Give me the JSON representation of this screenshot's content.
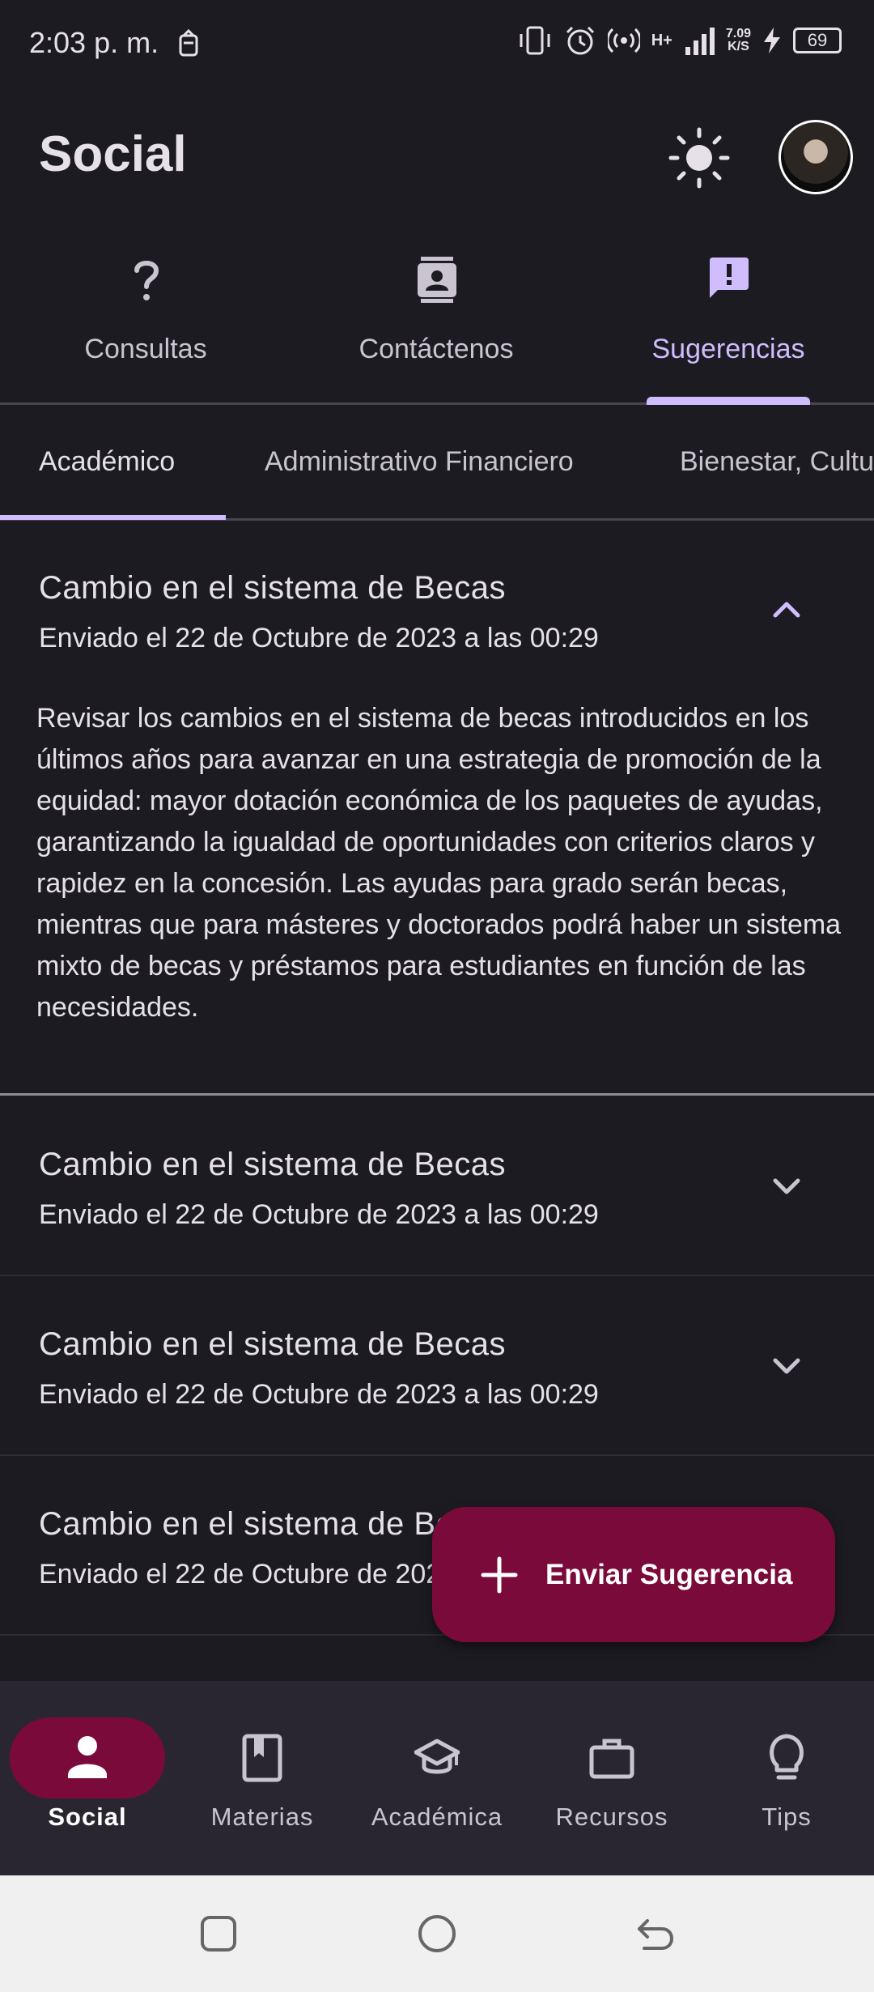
{
  "status_bar": {
    "time": "2:03 p. m.",
    "network": "H+",
    "speed_value": "7.09",
    "speed_unit": "K/S",
    "battery": "69"
  },
  "header": {
    "title": "Social"
  },
  "top_tabs": [
    {
      "label": "Consultas",
      "icon": "question-icon"
    },
    {
      "label": "Contáctenos",
      "icon": "contact-icon"
    },
    {
      "label": "Sugerencias",
      "icon": "feedback-icon",
      "active": true
    }
  ],
  "sub_tabs": [
    {
      "label": "Académico",
      "active": true
    },
    {
      "label": "Administrativo Financiero"
    },
    {
      "label": "Bienestar, Cultu"
    }
  ],
  "suggestions": [
    {
      "title": "Cambio en el sistema de Becas",
      "subtitle": "Enviado el 22 de Octubre de 2023 a las 00:29",
      "expanded": true,
      "body": "Revisar los cambios en el sistema de becas introducidos en los últimos años para avanzar en una estrategia de promoción de la equidad: mayor dotación económica de los paquetes de ayudas, garantizando la igualdad de oportunidades con criterios claros y rapidez en la concesión. Las ayudas para grado serán becas, mientras que para másteres y doctorados podrá haber un sistema mixto de becas y préstamos para estudiantes en función de las necesidades."
    },
    {
      "title": "Cambio en el sistema de Becas",
      "subtitle": "Enviado el 22 de Octubre de 2023 a las 00:29",
      "expanded": false
    },
    {
      "title": "Cambio en el sistema de Becas",
      "subtitle": "Enviado el 22 de Octubre de 2023 a las 00:29",
      "expanded": false
    },
    {
      "title": "Cambio en el sistema de Becas",
      "subtitle": "Enviado el 22 de Octubre de 2023 a las 00:29",
      "expanded": false
    }
  ],
  "fab": {
    "label": "Enviar Sugerencia",
    "icon": "plus-icon"
  },
  "bottom_nav": [
    {
      "label": "Social",
      "icon": "person-icon",
      "active": true
    },
    {
      "label": "Materias",
      "icon": "book-icon"
    },
    {
      "label": "Académica",
      "icon": "school-icon"
    },
    {
      "label": "Recursos",
      "icon": "briefcase-icon"
    },
    {
      "label": "Tips",
      "icon": "lightbulb-icon"
    }
  ],
  "colors": {
    "background": "#1c1b21",
    "accent": "#cfbdfe",
    "brand": "#7a0a3a",
    "nav_bg": "#29262f"
  }
}
